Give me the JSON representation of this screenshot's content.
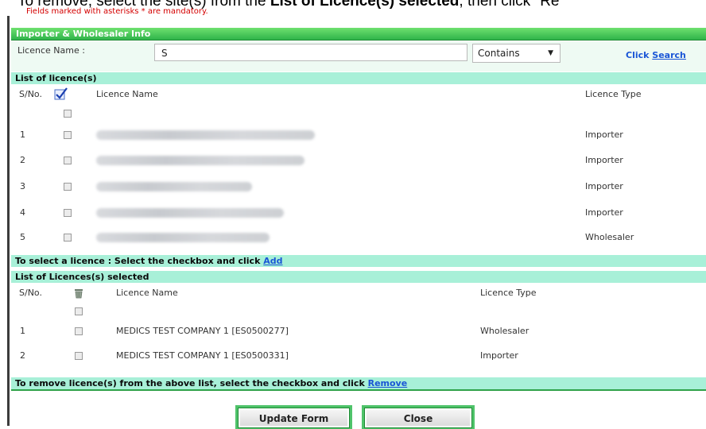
{
  "instruction": {
    "prefix": "To remove, select the site(s) from the ",
    "bold": "List of Licence(s) selected",
    "suffix": ", then click \"Re"
  },
  "mandatory_note": "Fields marked with asterisks * are mandatory.",
  "panel": {
    "title": "Importer & Wholesaler Info",
    "licence_name_label": "Licence Name :",
    "licence_name_value": "S",
    "match_mode": "Contains",
    "click_label": "Click",
    "search_link": "Search"
  },
  "list": {
    "title": "List of licence(s)",
    "col_sno": "S/No.",
    "col_name": "Licence Name",
    "col_type": "Licence Type",
    "rows": [
      {
        "sno": "1",
        "type": "Importer"
      },
      {
        "sno": "2",
        "type": "Importer"
      },
      {
        "sno": "3",
        "type": "Importer"
      },
      {
        "sno": "4",
        "type": "Importer"
      },
      {
        "sno": "5",
        "type": "Wholesaler"
      }
    ]
  },
  "select_hint": {
    "text": "To select a licence : Select the checkbox and click",
    "link": "Add"
  },
  "selected": {
    "title": "List of Licences(s) selected",
    "col_sno": "S/No.",
    "col_name": "Licence Name",
    "col_type": "Licence Type",
    "rows": [
      {
        "sno": "1",
        "name": "MEDICS TEST COMPANY 1 [ES0500277]",
        "type": "Wholesaler"
      },
      {
        "sno": "2",
        "name": "MEDICS TEST COMPANY 1 [ES0500331]",
        "type": "Importer"
      }
    ]
  },
  "remove_hint": {
    "text": "To remove licence(s) from the above list, select the checkbox and click",
    "link": "Remove"
  },
  "buttons": {
    "update": "Update Form",
    "close": "Close"
  }
}
